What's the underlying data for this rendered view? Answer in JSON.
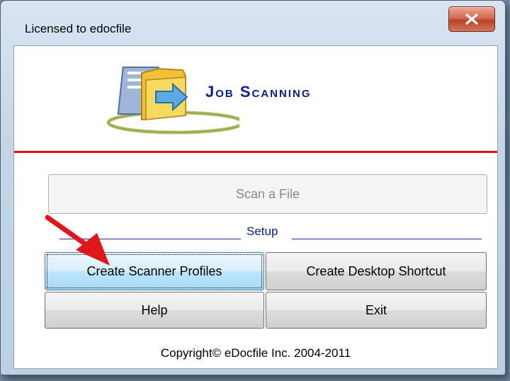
{
  "window": {
    "title": "Licensed to edocfile"
  },
  "app": {
    "title": "Job Scanning"
  },
  "buttons": {
    "scan_file": "Scan a File",
    "create_scanner_profiles": "Create Scanner Profiles",
    "create_desktop_shortcut": "Create Desktop Shortcut",
    "help": "Help",
    "exit": "Exit"
  },
  "setup": {
    "label": "Setup"
  },
  "footer": {
    "copyright": "Copyright© eDocfile Inc. 2004-2011"
  },
  "icons": {
    "close": "close-icon",
    "logo": "folder-logo-icon",
    "annotation": "red-arrow-icon"
  },
  "colors": {
    "title_blue": "#0b1c8c",
    "divider_red": "#e01010",
    "close_red": "#c9553b"
  }
}
